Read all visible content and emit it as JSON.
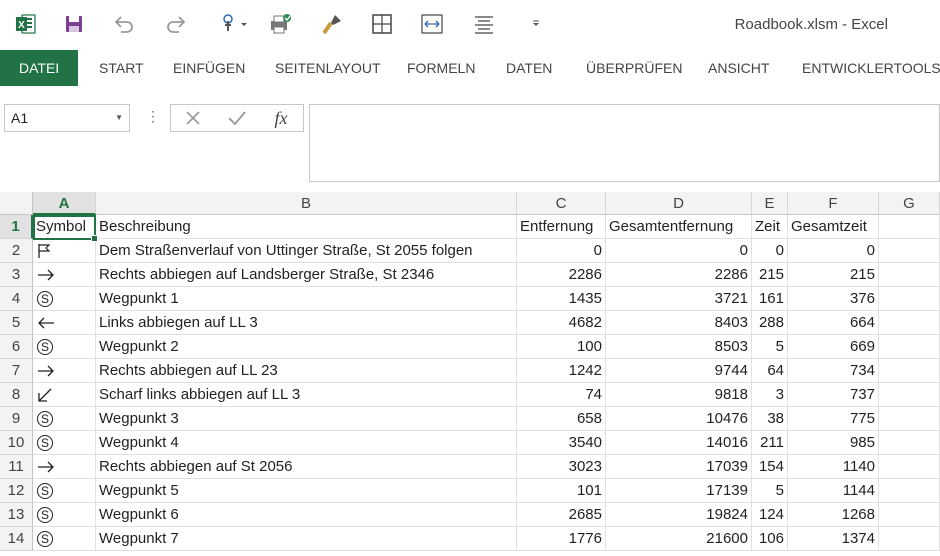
{
  "window": {
    "title": "Roadbook.xlsm - Excel"
  },
  "quick_access": [
    {
      "icon": "excel-logo-icon"
    },
    {
      "icon": "save-icon"
    },
    {
      "icon": "undo-icon"
    },
    {
      "icon": "redo-icon"
    },
    {
      "icon": "touch-mode-icon"
    },
    {
      "icon": "print-preview-icon"
    },
    {
      "icon": "format-painter-icon"
    },
    {
      "icon": "borders-icon"
    },
    {
      "icon": "column-width-icon"
    },
    {
      "icon": "align-icon"
    },
    {
      "icon": "customize-qat-icon"
    }
  ],
  "ribbon": {
    "file_tab": "DATEI",
    "tabs": [
      "START",
      "EINFÜGEN",
      "SEITENLAYOUT",
      "FORMELN",
      "DATEN",
      "ÜBERPRÜFEN",
      "ANSICHT",
      "ENTWICKLERTOOLS"
    ]
  },
  "formula_bar": {
    "name_box": "A1",
    "formula": "",
    "fx_label": "fx"
  },
  "columns": [
    "A",
    "B",
    "C",
    "D",
    "E",
    "F",
    "G"
  ],
  "selected_cell": "A1",
  "rows": [
    {
      "n": "1",
      "a": "Symbol",
      "b": "Beschreibung",
      "c": "Entfernung",
      "d": "Gesamtentfernung",
      "e": "Zeit",
      "f": "Gesamtzeit",
      "header": true
    },
    {
      "n": "2",
      "sym": "flag",
      "b": "Dem Straßenverlauf von Uttinger Straße, St 2055 folgen",
      "c": "0",
      "d": "0",
      "e": "0",
      "f": "0"
    },
    {
      "n": "3",
      "sym": "right",
      "b": "Rechts abbiegen auf Landsberger Straße, St 2346",
      "c": "2286",
      "d": "2286",
      "e": "215",
      "f": "215"
    },
    {
      "n": "4",
      "sym": "waypoint",
      "b": "Wegpunkt 1",
      "c": "1435",
      "d": "3721",
      "e": "161",
      "f": "376"
    },
    {
      "n": "5",
      "sym": "left",
      "b": "Links abbiegen auf LL 3",
      "c": "4682",
      "d": "8403",
      "e": "288",
      "f": "664"
    },
    {
      "n": "6",
      "sym": "waypoint",
      "b": "Wegpunkt 2",
      "c": "100",
      "d": "8503",
      "e": "5",
      "f": "669"
    },
    {
      "n": "7",
      "sym": "right",
      "b": "Rechts abbiegen auf LL 23",
      "c": "1242",
      "d": "9744",
      "e": "64",
      "f": "734"
    },
    {
      "n": "8",
      "sym": "sharp-left",
      "b": "Scharf links abbiegen auf LL 3",
      "c": "74",
      "d": "9818",
      "e": "3",
      "f": "737"
    },
    {
      "n": "9",
      "sym": "waypoint",
      "b": "Wegpunkt 3",
      "c": "658",
      "d": "10476",
      "e": "38",
      "f": "775"
    },
    {
      "n": "10",
      "sym": "waypoint",
      "b": "Wegpunkt 4",
      "c": "3540",
      "d": "14016",
      "e": "211",
      "f": "985"
    },
    {
      "n": "11",
      "sym": "right",
      "b": "Rechts abbiegen auf St 2056",
      "c": "3023",
      "d": "17039",
      "e": "154",
      "f": "1140"
    },
    {
      "n": "12",
      "sym": "waypoint",
      "b": "Wegpunkt 5",
      "c": "101",
      "d": "17139",
      "e": "5",
      "f": "1144"
    },
    {
      "n": "13",
      "sym": "waypoint",
      "b": "Wegpunkt 6",
      "c": "2685",
      "d": "19824",
      "e": "124",
      "f": "1268"
    },
    {
      "n": "14",
      "sym": "waypoint",
      "b": "Wegpunkt 7",
      "c": "1776",
      "d": "21600",
      "e": "106",
      "f": "1374"
    }
  ],
  "colors": {
    "accent": "#217346"
  }
}
